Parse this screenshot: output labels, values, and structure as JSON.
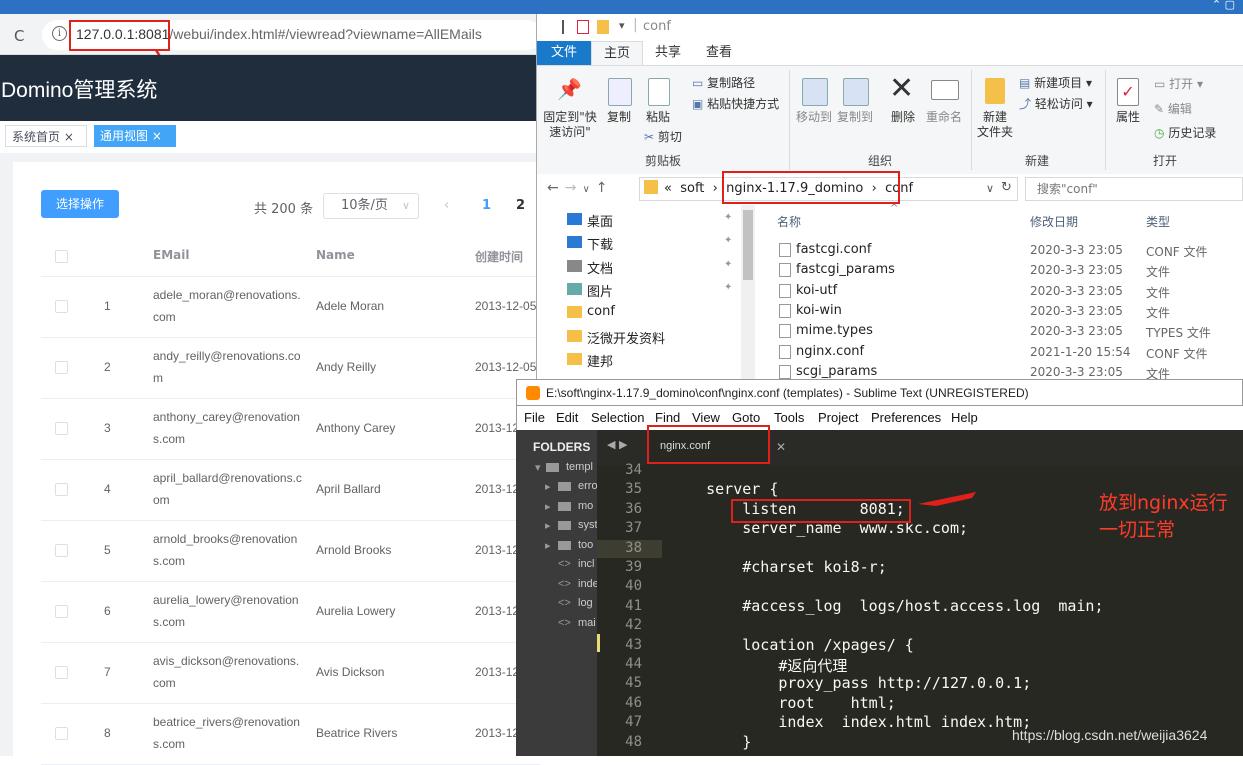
{
  "browser": {
    "url_host": "127.0.0.1:8081",
    "url_path": "/webui/index.html#/viewread?viewname=AllEMails"
  },
  "domino": {
    "app_title": "Domino管理系统",
    "tabs": [
      {
        "label": "系统首页 ×"
      },
      {
        "label": "通用视图 ×"
      }
    ],
    "select_button": "选择操作",
    "total": "共 200 条",
    "page_size": "10条/页",
    "pages": [
      "1",
      "2"
    ],
    "columns": [
      "EMail",
      "Name",
      "创建时间"
    ],
    "rows": [
      {
        "index": "1",
        "email": "adele_moran@renovations.com",
        "name": "Adele Moran",
        "created": "2013-12-05"
      },
      {
        "index": "2",
        "email": "andy_reilly@renovations.com",
        "name": "Andy Reilly",
        "created": "2013-12-05"
      },
      {
        "index": "3",
        "email": "anthony_carey@renovations.com",
        "name": "Anthony Carey",
        "created": "2013-12"
      },
      {
        "index": "4",
        "email": "april_ballard@renovations.com",
        "name": "April Ballard",
        "created": "2013-12"
      },
      {
        "index": "5",
        "email": "arnold_brooks@renovations.com",
        "name": "Arnold Brooks",
        "created": "2013-12"
      },
      {
        "index": "6",
        "email": "aurelia_lowery@renovations.com",
        "name": "Aurelia Lowery",
        "created": "2013-12"
      },
      {
        "index": "7",
        "email": "avis_dickson@renovations.com",
        "name": "Avis Dickson",
        "created": "2013-12"
      },
      {
        "index": "8",
        "email": "beatrice_rivers@renovations.com",
        "name": "Beatrice Rivers",
        "created": "2013-12"
      }
    ]
  },
  "explorer": {
    "title": "conf",
    "ribbon_tabs": [
      "文件",
      "主页",
      "共享",
      "查看"
    ],
    "ribbon": {
      "pin": "固定到\"快\n速访问\"",
      "copy": "复制",
      "paste": "粘贴",
      "copy_path": "复制路径",
      "paste_shortcut": "粘贴快捷方式",
      "cut": "剪切",
      "move_to": "移动到",
      "copy_to": "复制到",
      "delete": "删除",
      "rename": "重命名",
      "new_folder": "新建\n文件夹",
      "new_item": "新建项目 ▾",
      "easy_access": "轻松访问 ▾",
      "properties": "属性",
      "open": "打开 ▾",
      "edit": "编辑",
      "history": "历史记录",
      "groups": [
        "剪贴板",
        "组织",
        "新建",
        "打开"
      ]
    },
    "breadcrumb": [
      "«",
      "soft",
      "›",
      "nginx-1.17.9_domino",
      "›",
      "conf"
    ],
    "search_placeholder": "搜索\"conf\"",
    "sidebar": [
      "桌面",
      "下载",
      "文档",
      "图片",
      "conf",
      "泛微开发资料",
      "建邦"
    ],
    "columns": [
      "名称",
      "修改日期",
      "类型"
    ],
    "files": [
      {
        "name": "fastcgi.conf",
        "date": "2020-3-3 23:05",
        "type": "CONF 文件"
      },
      {
        "name": "fastcgi_params",
        "date": "2020-3-3 23:05",
        "type": "文件"
      },
      {
        "name": "koi-utf",
        "date": "2020-3-3 23:05",
        "type": "文件"
      },
      {
        "name": "koi-win",
        "date": "2020-3-3 23:05",
        "type": "文件"
      },
      {
        "name": "mime.types",
        "date": "2020-3-3 23:05",
        "type": "TYPES 文件"
      },
      {
        "name": "nginx.conf",
        "date": "2021-1-20 15:54",
        "type": "CONF 文件"
      },
      {
        "name": "scgi_params",
        "date": "2020-3-3 23:05",
        "type": "文件"
      }
    ]
  },
  "sublime": {
    "title": "E:\\soft\\nginx-1.17.9_domino\\conf\\nginx.conf (templates) - Sublime Text (UNREGISTERED)",
    "menu": [
      "File",
      "Edit",
      "Selection",
      "Find",
      "View",
      "Goto",
      "Tools",
      "Project",
      "Preferences",
      "Help"
    ],
    "folders_label": "FOLDERS",
    "tree": [
      "templ",
      "erro",
      "mo",
      "syst",
      "too",
      "incl",
      "inde",
      "log",
      "mai"
    ],
    "tab": "nginx.conf",
    "lines": [
      {
        "n": "34",
        "code": ""
      },
      {
        "n": "35",
        "code": "    server {"
      },
      {
        "n": "36",
        "code": "        listen       8081;"
      },
      {
        "n": "37",
        "code": "        server_name  www.skc.com;"
      },
      {
        "n": "38",
        "code": ""
      },
      {
        "n": "39",
        "code": "        #charset koi8-r;"
      },
      {
        "n": "40",
        "code": ""
      },
      {
        "n": "41",
        "code": "        #access_log  logs/host.access.log  main;"
      },
      {
        "n": "42",
        "code": ""
      },
      {
        "n": "43",
        "code": "        location /xpages/ {"
      },
      {
        "n": "44",
        "code": "            #返向代理"
      },
      {
        "n": "45",
        "code": "            proxy_pass http://127.0.0.1;"
      },
      {
        "n": "46",
        "code": "            root    html;"
      },
      {
        "n": "47",
        "code": "            index  index.html index.htm;"
      },
      {
        "n": "48",
        "code": "        }"
      }
    ]
  },
  "annotation": {
    "note_line1": "放到nginx运行",
    "note_line2": "一切正常"
  },
  "watermark": "https://blog.csdn.net/weijia3624",
  "colors": {
    "highlight": "#e0201b",
    "primary": "#409eff",
    "header_dark": "#1f2d3d",
    "editor_bg": "#272822"
  }
}
